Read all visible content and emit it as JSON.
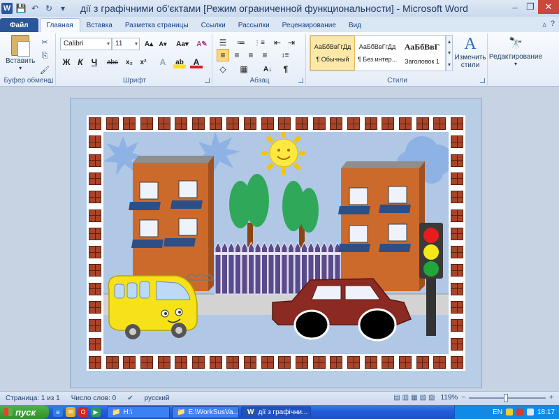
{
  "window": {
    "title": "дії з графічними об'єктами [Режим ограниченной функциональности] - Microsoft Word",
    "app_letter": "W",
    "controls": {
      "minimize": "–",
      "restore": "❐",
      "close": "✕"
    }
  },
  "quick_access": {
    "save": "💾",
    "undo": "↶",
    "redo": "↻",
    "more": "▾"
  },
  "ribbon_tabs": [
    "Файл",
    "Главная",
    "Вставка",
    "Разметка страницы",
    "Ссылки",
    "Рассылки",
    "Рецензирование",
    "Вид"
  ],
  "ribbon_tab_right": {
    "minimize": "▵",
    "help": "?"
  },
  "clipboard": {
    "label": "Буфер обмена",
    "paste": "Вставить",
    "paste_arrow": "▾",
    "cut": "✂",
    "copy": "⎘",
    "painter": "🖌"
  },
  "font": {
    "label": "Шрифт",
    "name": "Calibri",
    "size": "11",
    "grow": "A▴",
    "shrink": "A▾",
    "case": "Aa▾",
    "clear": "A✎",
    "bold": "Ж",
    "italic": "К",
    "underline": "Ч",
    "strike": "abc",
    "subscript": "x₂",
    "superscript": "x²",
    "effects": "A",
    "highlight": "ab",
    "color": "A"
  },
  "paragraph": {
    "label": "Абзац",
    "bullets": "☰",
    "numbering": "≔",
    "multilevel": "⋮≡",
    "decrease_indent": "⇤",
    "increase_indent": "⇥",
    "sort": "A↓",
    "pilcrow": "¶",
    "align_left": "≡",
    "align_center": "≡",
    "align_right": "≡",
    "justify": "≡",
    "spacing": "↕≡",
    "shading": "◇",
    "borders": "▦"
  },
  "styles": {
    "label": "Стили",
    "items": [
      {
        "sample": "АаБбВвГгДд",
        "name": "¶ Обычный"
      },
      {
        "sample": "АаБбВвГгДд",
        "name": "¶ Без интер..."
      },
      {
        "sample": "АаБбВвГ",
        "name": "Заголовок 1"
      }
    ],
    "change": "Изменить",
    "change2": "стили",
    "change_glyph": "A",
    "up": "▴",
    "down": "▾",
    "more": "▾"
  },
  "editing": {
    "label": "Редактирование",
    "glyph": "🔭",
    "arrow": "▾"
  },
  "status": {
    "page": "Страница: 1 из 1",
    "words": "Число слов: 0",
    "language": "русский",
    "spell_icon": "✔",
    "zoom": "119%",
    "zoom_minus": "−",
    "zoom_plus": "+"
  },
  "taskbar": {
    "start": "пуск",
    "tasks": [
      {
        "label": "H:\\",
        "icon": "📁"
      },
      {
        "label": "E:\\WorkSusVa...",
        "icon": "📁"
      },
      {
        "label": "дії з графічни...",
        "icon": "W"
      }
    ],
    "lang": "EN",
    "time": "18:17"
  },
  "scene": {
    "colors": {
      "sky": "#b0c8e6",
      "brick": "#a8442a",
      "building": "#cc6a2b",
      "roof": "#8e8e8e",
      "balcony": "#2e4f86",
      "fence": "#5b4a8a",
      "tree": "#2fa85a",
      "trunk": "#8b4513",
      "sun": "#ffe940",
      "bus": "#f7e21a",
      "car": "#8a2a22",
      "road": "#cfcfcf",
      "traffic_red": "#e81c1c",
      "traffic_yellow": "#f5e81a",
      "traffic_green": "#1fa83a"
    }
  }
}
